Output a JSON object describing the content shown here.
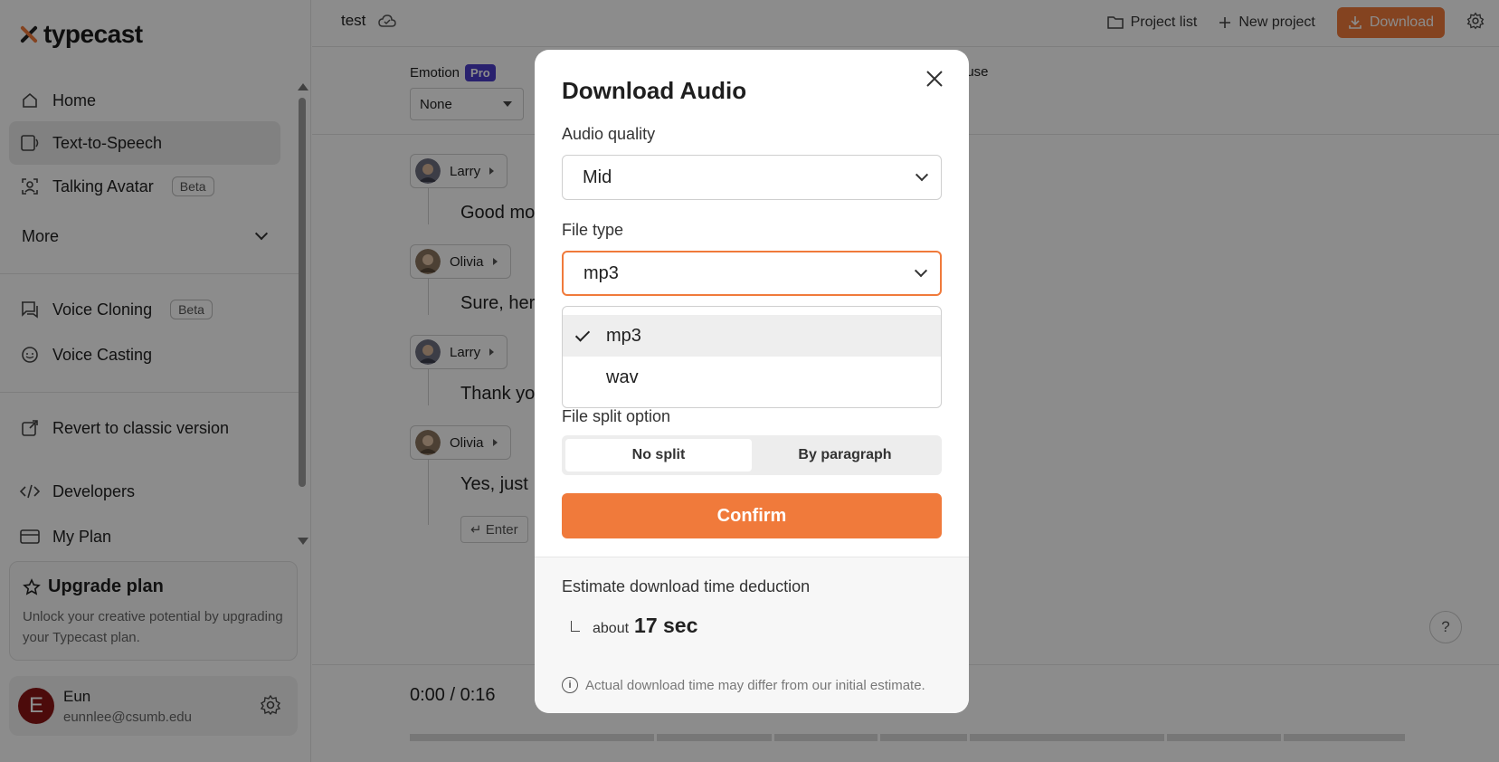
{
  "app": {
    "logo_text": "typecast"
  },
  "sidebar": {
    "items": [
      {
        "label": "Home",
        "icon": "home-icon"
      },
      {
        "label": "Text-to-Speech",
        "icon": "tts-icon"
      },
      {
        "label": "Talking Avatar",
        "icon": "avatar-icon",
        "badge": "Beta"
      }
    ],
    "more_label": "More",
    "items2": [
      {
        "label": "Voice Cloning",
        "icon": "chat-icon",
        "badge": "Beta"
      },
      {
        "label": "Voice Casting",
        "icon": "face-icon"
      }
    ],
    "revert_label": "Revert to classic version",
    "developers_label": "Developers",
    "myplan_label": "My Plan",
    "upgrade": {
      "title": "Upgrade plan",
      "text": "Unlock your creative potential by upgrading your Typecast plan."
    },
    "user": {
      "initial": "E",
      "name": "Eun",
      "email": "eunnlee@csumb.edu"
    }
  },
  "topbar": {
    "project_title": "test",
    "project_list": "Project list",
    "new_project": "New project",
    "download": "Download"
  },
  "toolbar": {
    "emotion_label": "Emotion",
    "pro_badge": "Pro",
    "emotion_value": "None",
    "pause_label": "ause"
  },
  "editor": {
    "lines": [
      {
        "speaker": "Larry",
        "text": "Good mo"
      },
      {
        "speaker": "Olivia",
        "text": "Sure, her"
      },
      {
        "speaker": "Larry",
        "text": "Thank yo"
      },
      {
        "speaker": "Olivia",
        "text": "Yes, just"
      }
    ],
    "enter_label": "↵ Enter",
    "help": "?"
  },
  "player": {
    "time": "0:00 / 0:16"
  },
  "modal": {
    "title": "Download Audio",
    "audio_quality_label": "Audio quality",
    "audio_quality_value": "Mid",
    "file_type_label": "File type",
    "file_type_value": "mp3",
    "file_type_options": [
      "mp3",
      "wav"
    ],
    "file_type_selected": "mp3",
    "file_split_label": "File split option",
    "split_options": [
      "No split",
      "By paragraph"
    ],
    "split_selected": "No split",
    "confirm_label": "Confirm",
    "estimate_title": "Estimate download time deduction",
    "estimate_about": "about",
    "estimate_value": "17 sec",
    "estimate_note": "Actual download time may differ from our initial estimate."
  },
  "colors": {
    "accent": "#f07a3b",
    "pro_badge": "#4b3cc9",
    "avatar": "#8b1414"
  }
}
